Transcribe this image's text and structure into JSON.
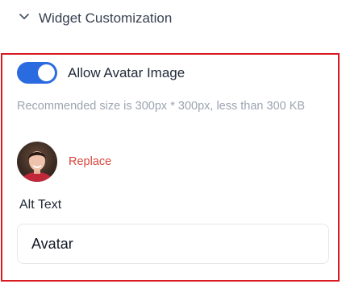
{
  "section": {
    "title": "Widget Customization",
    "icon": "chevron-down-icon"
  },
  "avatar_settings": {
    "toggle_label": "Allow Avatar Image",
    "toggle_on": true,
    "hint": "Recommended size is 300px * 300px, less than 300 KB",
    "replace_label": "Replace",
    "alt_label": "Alt Text",
    "alt_value": "Avatar"
  },
  "colors": {
    "accent": "#2b6be0",
    "highlight_border": "#d81b21",
    "link": "#d9463b",
    "muted_text": "#9ca3af"
  }
}
